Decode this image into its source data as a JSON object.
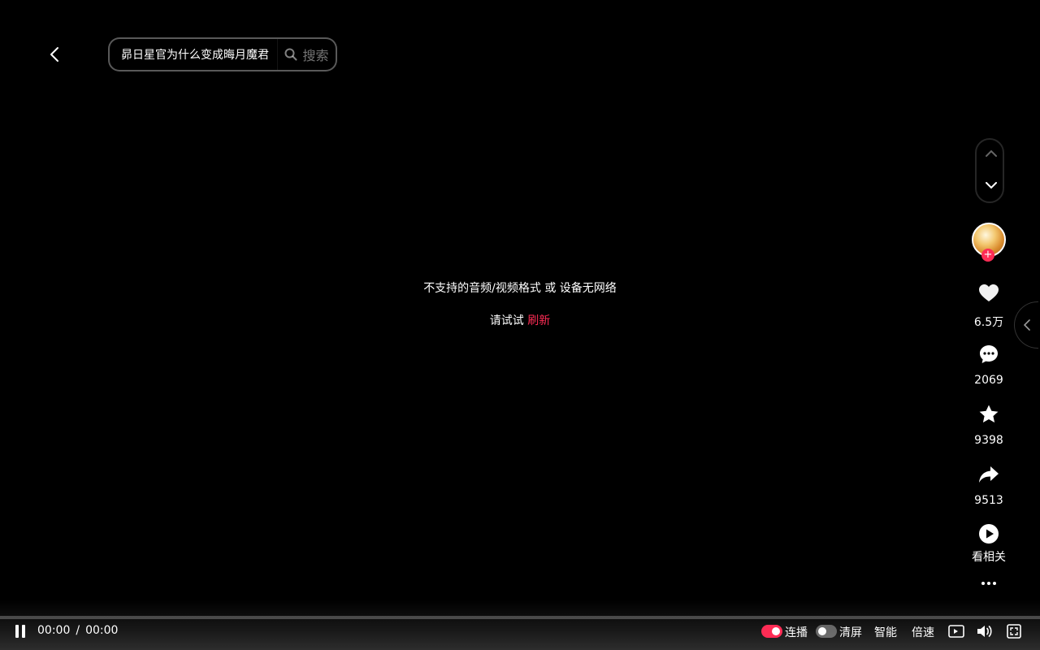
{
  "search": {
    "value": "昴日星官为什么变成晦月魔君",
    "button_label": "搜索"
  },
  "player": {
    "error_message": "不支持的音频/视频格式 或 设备无网络",
    "retry_prefix": "请试试",
    "refresh_label": "刷新"
  },
  "actions": {
    "like_count": "6.5万",
    "comment_count": "2069",
    "favorite_count": "9398",
    "share_count": "9513",
    "related_label": "看相关"
  },
  "controls": {
    "current_time": "00:00",
    "separator": "/",
    "duration": "00:00",
    "progress": 0,
    "autoplay_label": "连播",
    "autoplay_on": true,
    "clear_screen_label": "清屏",
    "clear_screen_on": false,
    "smart_label": "智能",
    "speed_label": "倍速"
  },
  "colors": {
    "accent": "#fe2c55",
    "background": "#000000"
  },
  "icons": {
    "back": "chevron-left-icon",
    "search": "search-icon",
    "nav_up": "chevron-up-icon",
    "nav_down": "chevron-down-icon",
    "like": "heart-icon",
    "comment": "comment-icon",
    "favorite": "star-icon",
    "share": "share-icon",
    "related": "play-circle-icon",
    "more": "more-dots-icon",
    "pause": "pause-icon",
    "volume": "volume-icon",
    "fullscreen": "fullscreen-icon",
    "side_toggle": "chevron-left-icon"
  }
}
